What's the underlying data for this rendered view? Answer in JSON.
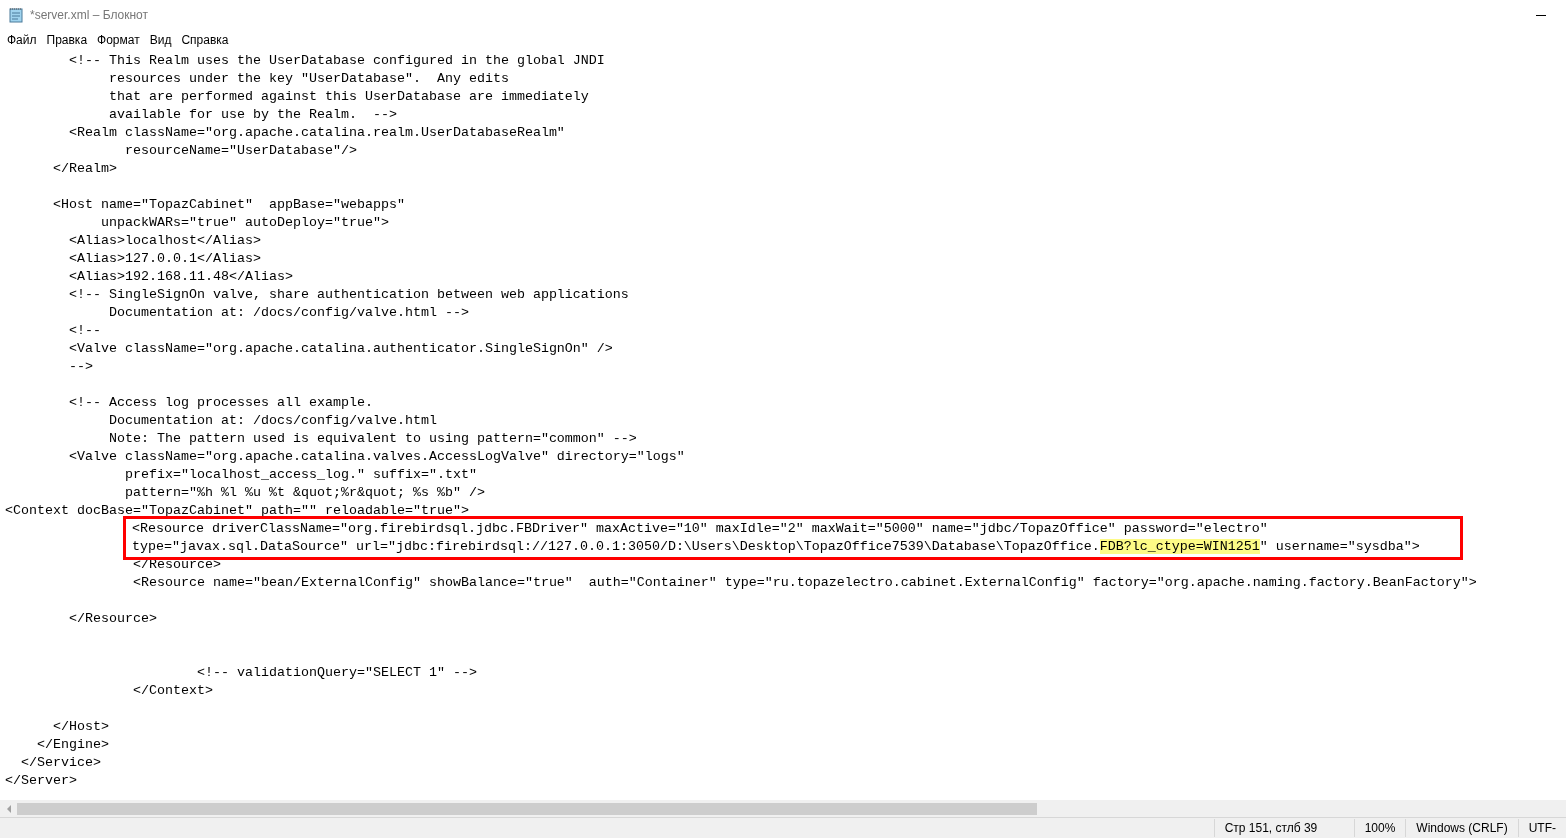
{
  "window": {
    "title": "*server.xml – Блокнот"
  },
  "menu": [
    "Файл",
    "Правка",
    "Формат",
    "Вид",
    "Справка"
  ],
  "editor": {
    "lines": [
      {
        "kind": "text",
        "text": "        <!-- This Realm uses the UserDatabase configured in the global JNDI"
      },
      {
        "kind": "text",
        "text": "             resources under the key \"UserDatabase\".  Any edits"
      },
      {
        "kind": "text",
        "text": "             that are performed against this UserDatabase are immediately"
      },
      {
        "kind": "text",
        "text": "             available for use by the Realm.  -->"
      },
      {
        "kind": "text",
        "text": "        <Realm className=\"org.apache.catalina.realm.UserDatabaseRealm\""
      },
      {
        "kind": "text",
        "text": "               resourceName=\"UserDatabase\"/>"
      },
      {
        "kind": "text",
        "text": "      </Realm>"
      },
      {
        "kind": "blank"
      },
      {
        "kind": "text",
        "text": "      <Host name=\"TopazCabinet\"  appBase=\"webapps\""
      },
      {
        "kind": "text",
        "text": "            unpackWARs=\"true\" autoDeploy=\"true\">"
      },
      {
        "kind": "text",
        "text": "        <Alias>localhost</Alias>"
      },
      {
        "kind": "text",
        "text": "        <Alias>127.0.0.1</Alias>"
      },
      {
        "kind": "text",
        "text": "        <Alias>192.168.11.48</Alias>"
      },
      {
        "kind": "text",
        "text": "        <!-- SingleSignOn valve, share authentication between web applications"
      },
      {
        "kind": "text",
        "text": "             Documentation at: /docs/config/valve.html -->"
      },
      {
        "kind": "text",
        "text": "        <!--"
      },
      {
        "kind": "text",
        "text": "        <Valve className=\"org.apache.catalina.authenticator.SingleSignOn\" />"
      },
      {
        "kind": "text",
        "text": "        -->"
      },
      {
        "kind": "blank"
      },
      {
        "kind": "text",
        "text": "        <!-- Access log processes all example."
      },
      {
        "kind": "text",
        "text": "             Documentation at: /docs/config/valve.html"
      },
      {
        "kind": "text",
        "text": "             Note: The pattern used is equivalent to using pattern=\"common\" -->"
      },
      {
        "kind": "text",
        "text": "        <Valve className=\"org.apache.catalina.valves.AccessLogValve\" directory=\"logs\""
      },
      {
        "kind": "text",
        "text": "               prefix=\"localhost_access_log.\" suffix=\".txt\""
      },
      {
        "kind": "text",
        "text": "               pattern=\"%h %l %u %t &quot;%r&quot; %s %b\" />"
      },
      {
        "kind": "text",
        "text": "<Context docBase=\"TopazCabinet\" path=\"\" reloadable=\"true\">"
      },
      {
        "kind": "boxed",
        "segments": [
          {
            "text": "<Resource driverClassName=\"org.firebirdsql.jdbc.FBDriver\" maxActive=\"10\" maxIdle=\"2\" maxWait=\"5000\" name=\"jdbc/TopazOffice\" password=\"electro\"",
            "highlighted": false
          }
        ]
      },
      {
        "kind": "boxed",
        "segments": [
          {
            "text": "type=\"javax.sql.DataSource\" url=\"jdbc:firebirdsql://127.0.0.1:3050/D:\\Users\\Desktop\\TopazOffice7539\\Database\\TopazOffice.",
            "highlighted": false
          },
          {
            "text": "FDB?lc_ctype=WIN1251",
            "highlighted": true
          },
          {
            "text": "\" username=\"sysdba\">",
            "highlighted": false
          }
        ]
      },
      {
        "kind": "text",
        "text": "                </Resource>"
      },
      {
        "kind": "text",
        "text": "                <Resource name=\"bean/ExternalConfig\" showBalance=\"true\"  auth=\"Container\" type=\"ru.topazelectro.cabinet.ExternalConfig\" factory=\"org.apache.naming.factory.BeanFactory\">"
      },
      {
        "kind": "blank"
      },
      {
        "kind": "text",
        "text": "        </Resource>"
      },
      {
        "kind": "blank"
      },
      {
        "kind": "blank"
      },
      {
        "kind": "text",
        "text": "                        <!-- validationQuery=\"SELECT 1\" -->"
      },
      {
        "kind": "text",
        "text": "                </Context>"
      },
      {
        "kind": "blank"
      },
      {
        "kind": "text",
        "text": "      </Host>"
      },
      {
        "kind": "text",
        "text": "    </Engine>"
      },
      {
        "kind": "text",
        "text": "  </Service>"
      },
      {
        "kind": "text",
        "text": "</Server>"
      }
    ]
  },
  "status_bar": [
    "Стр 151, стлб 39",
    "100%",
    "Windows (CRLF)",
    "UTF-"
  ]
}
